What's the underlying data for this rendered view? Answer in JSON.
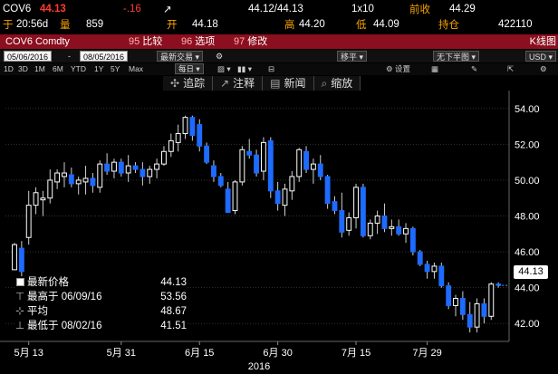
{
  "header": {
    "ticker": "COV6",
    "last_price": "44.13",
    "change": "-.16",
    "bid_ask": "44.12/44.13",
    "size": "1x10",
    "prev_close_label": "前收",
    "prev_close": "44.29",
    "time_label": "于",
    "time": "20:56d",
    "volume_label": "量",
    "volume": "859",
    "open_label": "开",
    "open": "44.18",
    "high_label": "高",
    "high": "44.20",
    "low_label": "低",
    "low": "44.09",
    "oi_label": "持仓",
    "oi": "422110"
  },
  "titlebar": {
    "ticker": "COV6 Comdty",
    "btn_compare_num": "95",
    "btn_compare": "比较",
    "btn_options_num": "96",
    "btn_options": "选项",
    "btn_edit_num": "97",
    "btn_edit": "修改",
    "right_label": "K线图"
  },
  "daterow": {
    "start": "05/06/2016",
    "end": "08/05/2016",
    "mode": "最新交易",
    "shift": "移平",
    "no_lower": "无下半图",
    "currency": "USD"
  },
  "periods": [
    "1D",
    "3D",
    "1M",
    "6M",
    "YTD",
    "1Y",
    "5Y",
    "Max"
  ],
  "period_freq": "每日",
  "toolbar": {
    "track": "追踪",
    "annotate": "注释",
    "news": "新闻",
    "zoom": "缩放"
  },
  "legend": {
    "last_label": "最新价格",
    "last_value": "44.13",
    "high_label": "最高于 06/09/16",
    "high_value": "53.56",
    "avg_label": "平均",
    "avg_value": "48.67",
    "low_label": "最低于 08/02/16",
    "low_value": "41.51"
  },
  "price_tag": "44.13",
  "chart_data": {
    "type": "candlestick",
    "x_tick_labels": [
      "5月 13",
      "5月 31",
      "6月 15",
      "6月 30",
      "7月 15",
      "7月 29"
    ],
    "x_axis_label": "2016",
    "y_ticks": [
      "42.00",
      "44.00",
      "46.00",
      "48.00",
      "50.00",
      "52.00",
      "54.00"
    ],
    "ylim": [
      41,
      55
    ],
    "colors": {
      "up": "#ffffff",
      "down": "#1e6bff",
      "grid": "#333333",
      "last_line": "#5aa0ff"
    },
    "candles": [
      {
        "o": 45.0,
        "h": 46.5,
        "l": 45.0,
        "c": 46.4
      },
      {
        "o": 46.2,
        "h": 46.6,
        "l": 44.6,
        "c": 44.9
      },
      {
        "o": 46.8,
        "h": 49.4,
        "l": 46.4,
        "c": 48.6
      },
      {
        "o": 48.6,
        "h": 49.6,
        "l": 48.1,
        "c": 49.3
      },
      {
        "o": 48.9,
        "h": 49.4,
        "l": 48.0,
        "c": 49.0
      },
      {
        "o": 49.0,
        "h": 50.6,
        "l": 48.7,
        "c": 50.0
      },
      {
        "o": 49.9,
        "h": 50.6,
        "l": 49.5,
        "c": 50.4
      },
      {
        "o": 50.2,
        "h": 51.0,
        "l": 49.6,
        "c": 50.4
      },
      {
        "o": 50.3,
        "h": 50.7,
        "l": 49.6,
        "c": 49.8
      },
      {
        "o": 49.8,
        "h": 50.2,
        "l": 49.2,
        "c": 50.0
      },
      {
        "o": 49.9,
        "h": 50.8,
        "l": 49.2,
        "c": 50.1
      },
      {
        "o": 50.1,
        "h": 50.4,
        "l": 49.3,
        "c": 49.7
      },
      {
        "o": 49.6,
        "h": 51.1,
        "l": 49.3,
        "c": 50.9
      },
      {
        "o": 50.9,
        "h": 51.5,
        "l": 50.3,
        "c": 50.5
      },
      {
        "o": 50.5,
        "h": 51.2,
        "l": 50.1,
        "c": 51.0
      },
      {
        "o": 51.0,
        "h": 51.2,
        "l": 50.2,
        "c": 50.4
      },
      {
        "o": 50.4,
        "h": 51.4,
        "l": 49.9,
        "c": 50.8
      },
      {
        "o": 50.8,
        "h": 51.0,
        "l": 50.4,
        "c": 50.6
      },
      {
        "o": 50.6,
        "h": 51.0,
        "l": 49.7,
        "c": 50.2
      },
      {
        "o": 50.2,
        "h": 50.8,
        "l": 49.8,
        "c": 50.6
      },
      {
        "o": 50.6,
        "h": 51.2,
        "l": 50.1,
        "c": 50.9
      },
      {
        "o": 50.9,
        "h": 51.9,
        "l": 50.8,
        "c": 51.6
      },
      {
        "o": 51.6,
        "h": 52.6,
        "l": 51.3,
        "c": 52.2
      },
      {
        "o": 52.1,
        "h": 53.1,
        "l": 51.6,
        "c": 52.6
      },
      {
        "o": 52.6,
        "h": 53.6,
        "l": 52.3,
        "c": 53.5
      },
      {
        "o": 53.5,
        "h": 53.6,
        "l": 52.2,
        "c": 52.5
      },
      {
        "o": 53.1,
        "h": 53.4,
        "l": 51.6,
        "c": 51.9
      },
      {
        "o": 51.9,
        "h": 52.1,
        "l": 50.9,
        "c": 51.0
      },
      {
        "o": 50.8,
        "h": 51.1,
        "l": 49.9,
        "c": 50.2
      },
      {
        "o": 50.2,
        "h": 50.4,
        "l": 49.6,
        "c": 49.7
      },
      {
        "o": 49.5,
        "h": 49.9,
        "l": 48.2,
        "c": 48.2
      },
      {
        "o": 48.3,
        "h": 50.0,
        "l": 48.1,
        "c": 49.9
      },
      {
        "o": 49.9,
        "h": 51.9,
        "l": 49.7,
        "c": 51.7
      },
      {
        "o": 51.6,
        "h": 52.3,
        "l": 51.2,
        "c": 51.4
      },
      {
        "o": 51.4,
        "h": 51.7,
        "l": 50.2,
        "c": 50.4
      },
      {
        "o": 50.5,
        "h": 52.4,
        "l": 50.0,
        "c": 52.1
      },
      {
        "o": 52.2,
        "h": 52.4,
        "l": 49.0,
        "c": 49.4
      },
      {
        "o": 49.4,
        "h": 49.9,
        "l": 48.3,
        "c": 48.7
      },
      {
        "o": 48.6,
        "h": 49.8,
        "l": 48.0,
        "c": 49.5
      },
      {
        "o": 49.4,
        "h": 50.5,
        "l": 48.9,
        "c": 50.2
      },
      {
        "o": 50.2,
        "h": 51.8,
        "l": 49.9,
        "c": 51.7
      },
      {
        "o": 51.6,
        "h": 51.9,
        "l": 50.4,
        "c": 50.6
      },
      {
        "o": 50.6,
        "h": 51.2,
        "l": 49.8,
        "c": 50.9
      },
      {
        "o": 50.9,
        "h": 51.4,
        "l": 50.0,
        "c": 50.2
      },
      {
        "o": 50.2,
        "h": 50.3,
        "l": 48.4,
        "c": 48.7
      },
      {
        "o": 48.8,
        "h": 49.1,
        "l": 48.1,
        "c": 48.3
      },
      {
        "o": 48.3,
        "h": 49.3,
        "l": 46.8,
        "c": 47.1
      },
      {
        "o": 47.2,
        "h": 48.2,
        "l": 46.9,
        "c": 47.9
      },
      {
        "o": 47.9,
        "h": 49.8,
        "l": 47.3,
        "c": 49.6
      },
      {
        "o": 49.6,
        "h": 49.8,
        "l": 46.8,
        "c": 46.9
      },
      {
        "o": 46.9,
        "h": 47.8,
        "l": 46.7,
        "c": 47.6
      },
      {
        "o": 47.6,
        "h": 48.3,
        "l": 47.0,
        "c": 48.0
      },
      {
        "o": 48.0,
        "h": 48.7,
        "l": 47.1,
        "c": 47.3
      },
      {
        "o": 47.3,
        "h": 47.8,
        "l": 46.9,
        "c": 47.4
      },
      {
        "o": 47.4,
        "h": 47.8,
        "l": 46.9,
        "c": 47.0
      },
      {
        "o": 47.0,
        "h": 47.6,
        "l": 46.5,
        "c": 47.3
      },
      {
        "o": 47.3,
        "h": 47.4,
        "l": 45.8,
        "c": 46.0
      },
      {
        "o": 46.0,
        "h": 46.1,
        "l": 45.2,
        "c": 45.3
      },
      {
        "o": 45.3,
        "h": 45.5,
        "l": 44.5,
        "c": 44.9
      },
      {
        "o": 44.9,
        "h": 45.4,
        "l": 44.5,
        "c": 45.2
      },
      {
        "o": 45.2,
        "h": 45.4,
        "l": 44.0,
        "c": 44.1
      },
      {
        "o": 44.1,
        "h": 44.3,
        "l": 42.8,
        "c": 43.0
      },
      {
        "o": 43.0,
        "h": 43.6,
        "l": 42.4,
        "c": 43.4
      },
      {
        "o": 43.4,
        "h": 43.8,
        "l": 42.2,
        "c": 42.5
      },
      {
        "o": 42.5,
        "h": 43.2,
        "l": 41.5,
        "c": 41.8
      },
      {
        "o": 41.8,
        "h": 43.4,
        "l": 41.5,
        "c": 43.1
      },
      {
        "o": 43.1,
        "h": 43.4,
        "l": 42.0,
        "c": 42.4
      },
      {
        "o": 42.4,
        "h": 44.3,
        "l": 42.2,
        "c": 44.2
      },
      {
        "o": 44.2,
        "h": 44.3,
        "l": 44.0,
        "c": 44.13
      }
    ]
  }
}
